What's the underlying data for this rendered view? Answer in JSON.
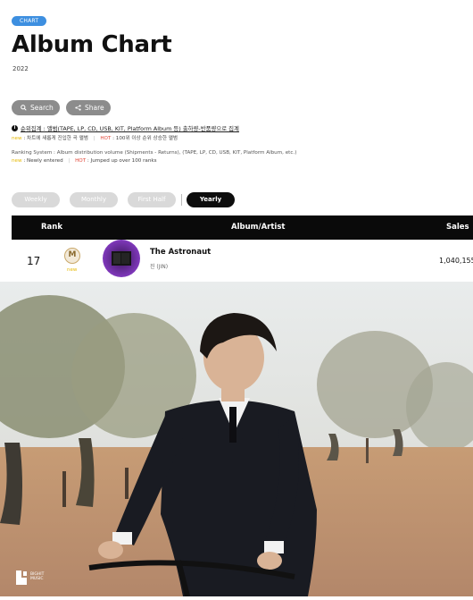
{
  "header": {
    "tag": "CHART",
    "title": "Album Chart",
    "year": "2022"
  },
  "actions": {
    "search_label": "Search",
    "share_label": "Share"
  },
  "notes": {
    "criteria": "순위집계 : 앨범(TAPE, LP, CD, USB, KIT, Platform Album 등) 출하량-반품량으로 집계",
    "legend_ko": {
      "new_tag": "new",
      "new_text": ": 차트에 새롭게 진입한 곡 앨범",
      "hot_tag": "HOT",
      "hot_text": ": 100위 이상 순위 상승한 앨범"
    },
    "system_en": "Ranking System : Album distribution volume (Shipments - Returns), (TAPE, LP, CD, USB, KIT, Platform Album, etc.)",
    "legend_en": {
      "new_tag": "new",
      "new_text": ": Newly entered",
      "hot_tag": "HOT",
      "hot_text": ": Jumped up over 100 ranks"
    }
  },
  "period_tabs": [
    {
      "label": "Weekly",
      "active": false
    },
    {
      "label": "Monthly",
      "active": false
    },
    {
      "label": "First Half",
      "active": false
    },
    {
      "label": "Yearly",
      "active": true
    }
  ],
  "table": {
    "columns": [
      "Rank",
      "Album/Artist",
      "Sales"
    ],
    "rows": [
      {
        "rank": "17",
        "badge": "M",
        "status": "new",
        "album": "The Astronaut",
        "artist": "진 (JIN)",
        "sales": "1,040,155"
      }
    ]
  },
  "photo": {
    "logo_text": [
      "BIGHIT",
      "MUSIC"
    ]
  },
  "colors": {
    "tag_blue": "#3d8fe0",
    "new_yellow": "#e6b800",
    "hot_red": "#e2483a",
    "header_black": "#0a0a0a"
  }
}
